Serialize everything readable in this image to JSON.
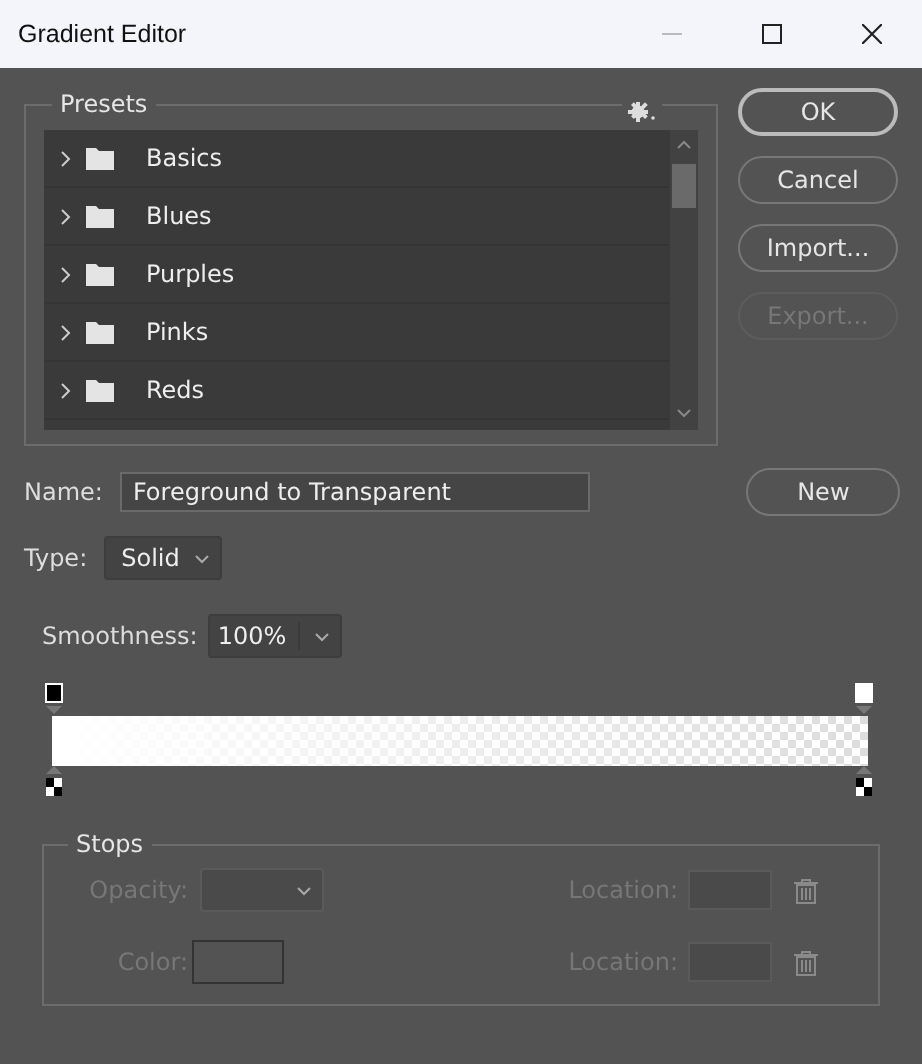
{
  "window": {
    "title": "Gradient Editor"
  },
  "presets": {
    "label": "Presets",
    "items": [
      {
        "label": "Basics",
        "expanded": false
      },
      {
        "label": "Blues",
        "expanded": false
      },
      {
        "label": "Purples",
        "expanded": false
      },
      {
        "label": "Pinks",
        "expanded": false
      },
      {
        "label": "Reds",
        "expanded": false
      }
    ]
  },
  "buttons": [
    {
      "label": "OK",
      "disabled": false,
      "kind": "default"
    },
    {
      "label": "Cancel",
      "disabled": false,
      "kind": "normal"
    },
    {
      "label": "Import...",
      "disabled": false,
      "kind": "normal"
    },
    {
      "label": "Export...",
      "disabled": true,
      "kind": "normal"
    }
  ],
  "name": {
    "label": "Name:",
    "value": "Foreground to Transparent"
  },
  "new_button": {
    "label": "New"
  },
  "type": {
    "label": "Type:",
    "value": "Solid"
  },
  "smoothness": {
    "label": "Smoothness:",
    "value": "100%"
  },
  "stops": {
    "label": "Stops",
    "disabled": true,
    "opacity": {
      "label": "Opacity:"
    },
    "color": {
      "label": "Color:"
    },
    "locations": [
      {
        "label": "Location:"
      },
      {
        "label": "Location:"
      }
    ]
  }
}
